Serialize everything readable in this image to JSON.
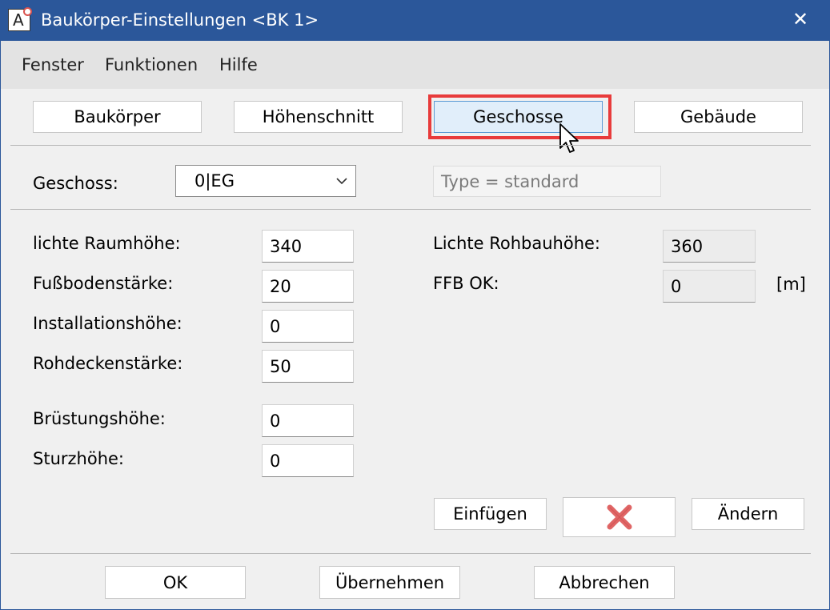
{
  "window": {
    "title": "Baukörper-Einstellungen <BK 1>",
    "app_icon_letter": "A",
    "close_glyph": "✕"
  },
  "menu": [
    "Fenster",
    "Funktionen",
    "Hilfe"
  ],
  "tabs": {
    "items": [
      "Baukörper",
      "Höhenschnitt",
      "Geschosse",
      "Gebäude"
    ],
    "active": "Geschosse"
  },
  "geschoss": {
    "label": "Geschoss:",
    "value": "0|EG",
    "type_placeholder": "Type = standard"
  },
  "fields_left": [
    {
      "label": "lichte Raumhöhe:",
      "value": "340"
    },
    {
      "label": "Fußbodenstärke:",
      "value": "20"
    },
    {
      "label": "Installationshöhe:",
      "value": "0"
    },
    {
      "label": "Rohdeckenstärke:",
      "value": "50"
    },
    {
      "label": "Brüstungshöhe:",
      "value": "0"
    },
    {
      "label": "Sturzhöhe:",
      "value": "0"
    }
  ],
  "fields_right": [
    {
      "label": "Lichte Rohbauhöhe:",
      "value": "360"
    },
    {
      "label": "FFB OK:",
      "value": "0",
      "unit": "[m]"
    }
  ],
  "actions": {
    "insert": "Einfügen",
    "delete_icon": "red-x-icon",
    "change": "Ändern"
  },
  "footer": {
    "ok": "OK",
    "apply": "Übernehmen",
    "cancel": "Abbrechen"
  },
  "colors": {
    "titlebar": "#2b579a",
    "highlight": "#e83b3b",
    "delete_x": "#e06666"
  }
}
